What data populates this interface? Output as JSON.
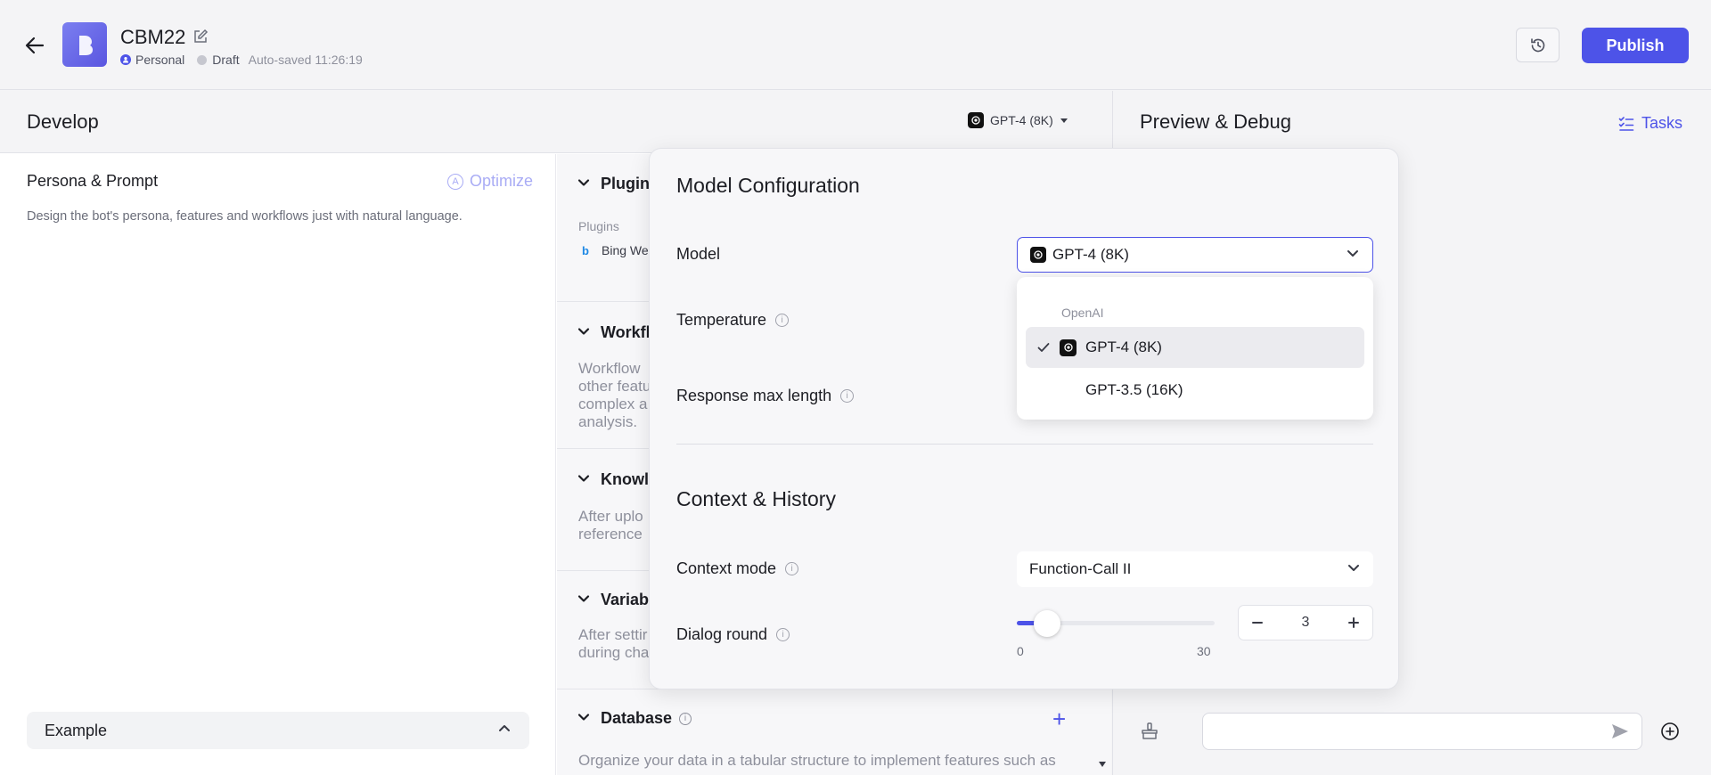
{
  "header": {
    "bot_name": "CBM22",
    "space": "Personal",
    "status": "Draft",
    "autosave": "Auto-saved 11:26:19",
    "publish_label": "Publish"
  },
  "develop": {
    "title": "Develop",
    "model_chip": "GPT-4 (8K)",
    "persona": {
      "title": "Persona & Prompt",
      "optimize": "Optimize",
      "description": "Design the bot's persona, features and workflows just with natural language."
    },
    "example_label": "Example",
    "sections": {
      "plugins": {
        "title": "Plugins",
        "sub_label": "Plugins",
        "item": "Bing We"
      },
      "workflow": {
        "title": "Workfl",
        "text": [
          "Workflow",
          "other featu",
          "complex a",
          "analysis."
        ]
      },
      "knowledge": {
        "title": "Knowle",
        "text": [
          "After uplo",
          "reference"
        ]
      },
      "variables": {
        "title": "Variabl",
        "text": [
          "After settir",
          "during cha"
        ]
      },
      "database": {
        "title": "Database",
        "text": "Organize your data in a tabular structure to implement features such as"
      }
    }
  },
  "preview": {
    "title": "Preview & Debug",
    "tasks_label": "Tasks"
  },
  "model_config": {
    "title": "Model Configuration",
    "model_label": "Model",
    "model_value": "GPT-4 (8K)",
    "temperature_label": "Temperature",
    "response_label": "Response max length",
    "dropdown": {
      "group": "OpenAI",
      "options": [
        {
          "label": "GPT-4 (8K)",
          "selected": true
        },
        {
          "label": "GPT-3.5 (16K)",
          "selected": false
        }
      ]
    },
    "context_title": "Context & History",
    "context_mode_label": "Context mode",
    "context_mode_value": "Function-Call II",
    "dialog_round_label": "Dialog round",
    "dialog_round": {
      "value": "3",
      "min": "0",
      "max": "30",
      "level": 3
    }
  },
  "colors": {
    "accent": "#4d53e8",
    "background": "#f4f4f6"
  }
}
